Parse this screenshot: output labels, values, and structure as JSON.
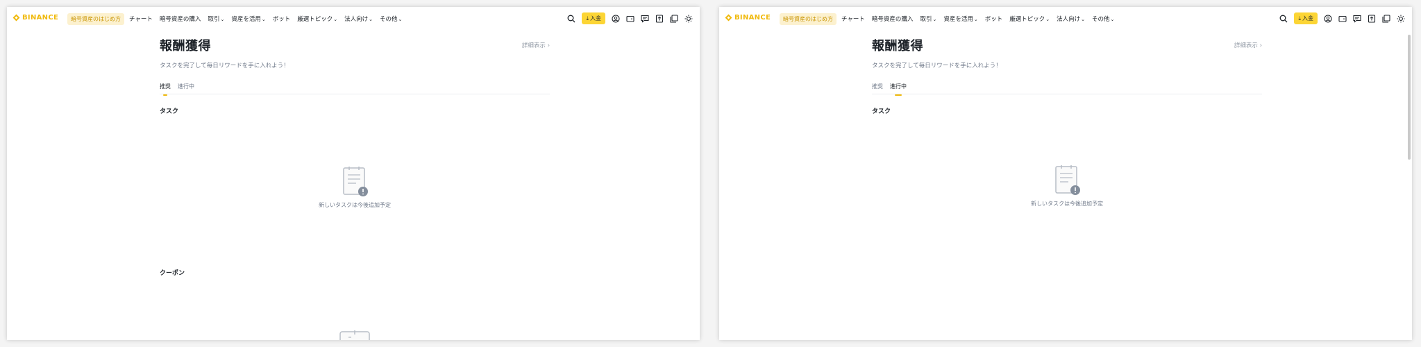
{
  "brand": {
    "name": "BINANCE",
    "accent": "#f0b90b"
  },
  "nav": {
    "getting_started": "暗号資産のはじめ方",
    "items": [
      {
        "label": "チャート",
        "dropdown": false
      },
      {
        "label": "暗号資産の購入",
        "dropdown": false
      },
      {
        "label": "取引",
        "dropdown": true
      },
      {
        "label": "資産を活用",
        "dropdown": true
      },
      {
        "label": "ボット",
        "dropdown": false
      },
      {
        "label": "厳選トピック",
        "dropdown": true
      },
      {
        "label": "法人向け",
        "dropdown": true
      },
      {
        "label": "その他",
        "dropdown": true
      }
    ],
    "deposit_label": "入金",
    "icons": [
      "search-icon",
      "download-icon",
      "account-icon",
      "wallet-icon",
      "messages-icon",
      "upload-icon",
      "layers-icon",
      "theme-sun-icon"
    ]
  },
  "windows": [
    {
      "active_tab": 0,
      "show_coupon": true
    },
    {
      "active_tab": 1,
      "show_coupon": false
    }
  ],
  "page": {
    "title": "報酬獲得",
    "details_link": "詳細表示",
    "subtitle": "タスクを完了して毎日リワードを手に入れよう！",
    "tabs": [
      "推奨",
      "進行中"
    ],
    "tasks_heading": "タスク",
    "empty_message": "新しいタスクは今後追加予定",
    "coupons_heading": "クーポン"
  }
}
